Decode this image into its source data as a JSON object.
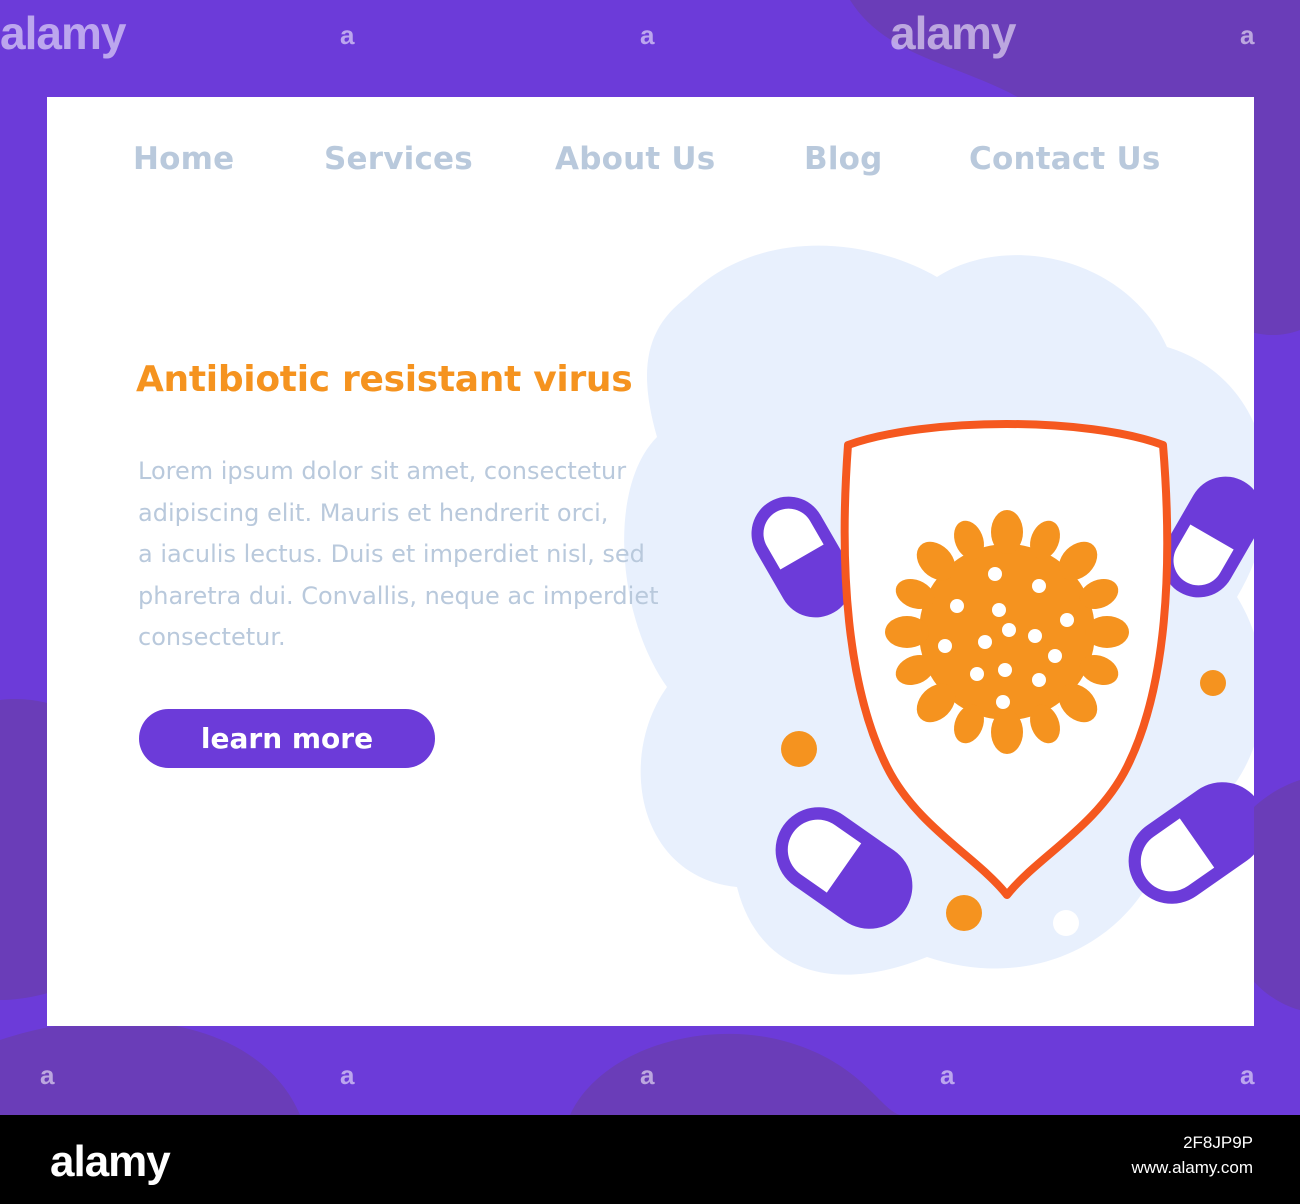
{
  "colors": {
    "purple": "#6c3bd9",
    "purple_dark": "#6a3db8",
    "orange": "#f5931f",
    "shield_red": "#f5581f",
    "muted_text": "#b9c9dc",
    "blob": "#e8f0fd"
  },
  "nav": {
    "items": [
      {
        "label": "Home"
      },
      {
        "label": "Services"
      },
      {
        "label": "About Us"
      },
      {
        "label": "Blog"
      },
      {
        "label": "Contact Us"
      }
    ]
  },
  "hero": {
    "title": "Antibiotic resistant virus",
    "body": "Lorem ipsum dolor sit amet, consectetur\nadipiscing elit. Mauris et hendrerit orci,\na iaculis lectus. Duis et imperdiet nisl, sed\npharetra dui. Convallis, neque ac imperdiet\nconsectetur.",
    "cta_label": "learn more"
  },
  "illustration": {
    "icons": [
      "shield-icon",
      "virus-icon",
      "pill-capsule-icon",
      "dot-icon"
    ]
  },
  "watermark": {
    "text": "alamy",
    "letter": "a"
  },
  "footer": {
    "logo": "alamy",
    "image_id": "2F8JP9P",
    "site": "www.alamy.com"
  }
}
